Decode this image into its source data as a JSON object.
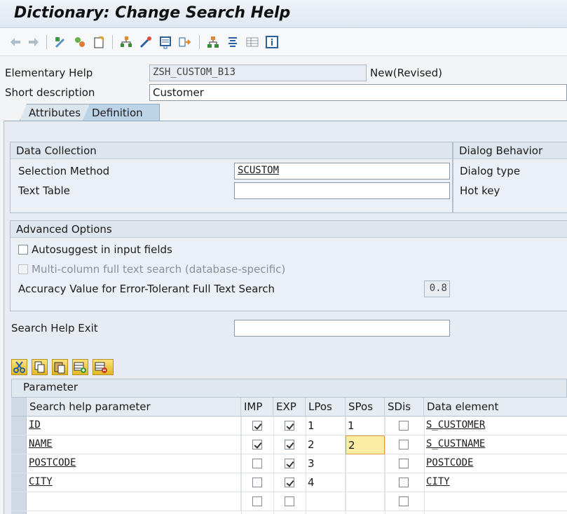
{
  "window": {
    "title": "Dictionary: Change Search Help"
  },
  "toolbar": {
    "icons": [
      "back-icon",
      "forward-icon",
      "display-change-icon",
      "other-object-icon",
      "activate-icon",
      "where-used-icon",
      "test-icon",
      "object-list-icon",
      "navigate-icon",
      "hierarchy-icon",
      "format-icon",
      "table-icon",
      "info-icon"
    ]
  },
  "header": {
    "elementary_help_label": "Elementary Help",
    "elementary_help_value": "ZSH_CUSTOM_B13",
    "status": "New(Revised)",
    "short_description_label": "Short description",
    "short_description_value": "Customer"
  },
  "tabs": [
    {
      "label": "Attributes"
    },
    {
      "label": "Definition"
    }
  ],
  "data_collection": {
    "title": "Data Collection",
    "selection_method_label": "Selection Method",
    "selection_method_value": "SCUSTOM",
    "text_table_label": "Text Table",
    "text_table_value": ""
  },
  "dialog_behavior": {
    "title": "Dialog Behavior",
    "dialog_type_label": "Dialog type",
    "hot_key_label": "Hot key"
  },
  "advanced_options": {
    "title": "Advanced Options",
    "autosuggest_label": "Autosuggest in input fields",
    "autosuggest_checked": false,
    "multicolumn_label": "Multi-column full text search (database-specific)",
    "multicolumn_checked": false,
    "accuracy_label": "Accuracy Value for Error-Tolerant Full Text Search",
    "accuracy_value": "0.8"
  },
  "search_help_exit": {
    "label": "Search Help Exit",
    "value": ""
  },
  "parameter_table": {
    "title": "Parameter",
    "columns": [
      "Search help parameter",
      "IMP",
      "EXP",
      "LPos",
      "SPos",
      "SDis",
      "Data element"
    ],
    "rows": [
      {
        "param": "ID",
        "imp": true,
        "exp": true,
        "lpos": "1",
        "spos": "1",
        "sdis": false,
        "element": "S_CUSTOMER"
      },
      {
        "param": "NAME",
        "imp": true,
        "exp": true,
        "lpos": "2",
        "spos": "2",
        "sdis": false,
        "element": "S_CUSTNAME"
      },
      {
        "param": "POSTCODE",
        "imp": false,
        "exp": true,
        "lpos": "3",
        "spos": "",
        "sdis": false,
        "element": "POSTCODE"
      },
      {
        "param": "CITY",
        "imp": false,
        "exp": true,
        "lpos": "4",
        "spos": "",
        "sdis": false,
        "element": "CITY"
      },
      {
        "param": "",
        "imp": false,
        "exp": false,
        "lpos": "",
        "spos": "",
        "sdis": false,
        "element": ""
      }
    ]
  },
  "colors": {
    "accent": "#bcd3e8",
    "active_cell": "#fbeea3"
  }
}
